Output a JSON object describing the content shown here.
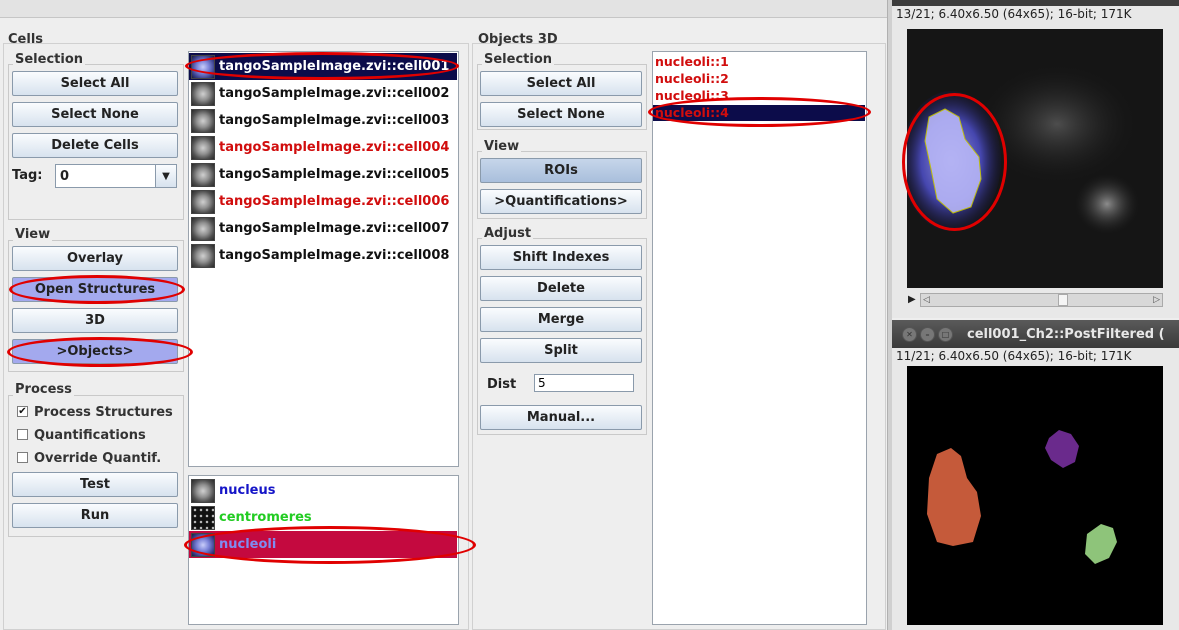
{
  "cells_panel": {
    "title": "Cells",
    "selection": {
      "label": "Selection",
      "select_all": "Select All",
      "select_none": "Select None",
      "delete_cells": "Delete Cells",
      "tag_label": "Tag:",
      "tag_value": "0"
    },
    "view": {
      "label": "View",
      "overlay": "Overlay",
      "open_structures": "Open Structures",
      "three_d": "3D",
      "objects": ">Objects>"
    },
    "process": {
      "label": "Process",
      "process_structures": "Process Structures",
      "process_structures_checked": true,
      "quantifications": "Quantifications",
      "quantifications_checked": false,
      "override_quantif": "Override Quantif.",
      "override_quantif_checked": false,
      "test": "Test",
      "run": "Run"
    },
    "cell_list": [
      {
        "name": "tangoSampleImage.zvi::cell001",
        "color": "#ffffff",
        "selected": true
      },
      {
        "name": "tangoSampleImage.zvi::cell002",
        "color": "#111111",
        "selected": false
      },
      {
        "name": "tangoSampleImage.zvi::cell003",
        "color": "#111111",
        "selected": false
      },
      {
        "name": "tangoSampleImage.zvi::cell004",
        "color": "#d10d0d",
        "selected": false
      },
      {
        "name": "tangoSampleImage.zvi::cell005",
        "color": "#111111",
        "selected": false
      },
      {
        "name": "tangoSampleImage.zvi::cell006",
        "color": "#d10d0d",
        "selected": false
      },
      {
        "name": "tangoSampleImage.zvi::cell007",
        "color": "#111111",
        "selected": false
      },
      {
        "name": "tangoSampleImage.zvi::cell008",
        "color": "#111111",
        "selected": false
      }
    ],
    "structure_list": [
      {
        "name": "nucleus",
        "color": "#1515c8",
        "selected": false
      },
      {
        "name": "centromeres",
        "color": "#22cc22",
        "selected": false
      },
      {
        "name": "nucleoli",
        "color": "#7f8cf0",
        "selected": true
      }
    ]
  },
  "objects_panel": {
    "title": "Objects 3D",
    "selection": {
      "label": "Selection",
      "select_all": "Select All",
      "select_none": "Select None"
    },
    "view": {
      "label": "View",
      "rois": "ROIs",
      "quantifications": ">Quantifications>"
    },
    "adjust": {
      "label": "Adjust",
      "shift_indexes": "Shift Indexes",
      "delete": "Delete",
      "merge": "Merge",
      "split": "Split",
      "dist_label": "Dist",
      "dist_value": "5",
      "manual": "Manual..."
    },
    "object_list": [
      "nucleoli::1",
      "nucleoli::2",
      "nucleoli::3",
      "nucleoli::4"
    ],
    "selected_object_index": 3
  },
  "image_window_1": {
    "info": "13/21; 6.40x6.50   (64x65); 16-bit; 171K"
  },
  "image_window_2": {
    "title": "cell001_Ch2::PostFiltered (",
    "info": "11/21; 6.40x6.50   (64x65); 16-bit; 171K"
  },
  "colors": {
    "highlight_red": "#e00000",
    "selected_list_bg": "#0c0c4a",
    "selected_structure_bg": "#c4093f",
    "active_button": "#a3a9ee"
  }
}
